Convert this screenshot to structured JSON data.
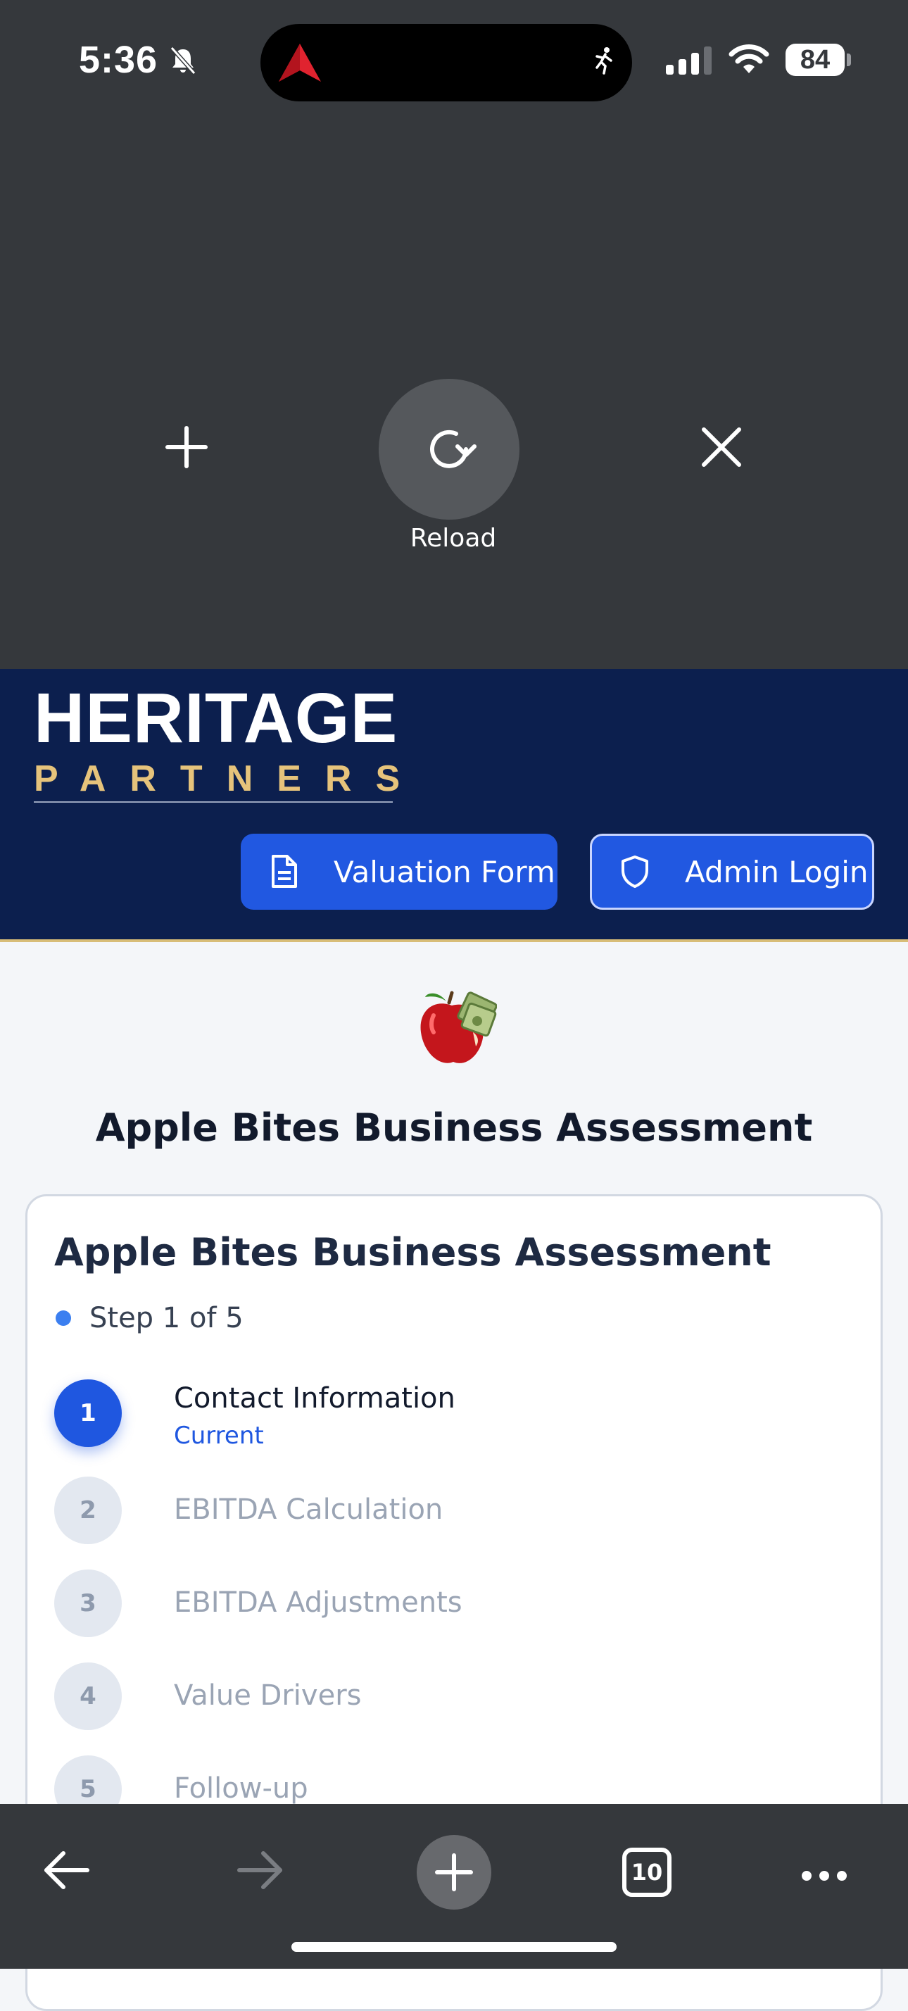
{
  "status_bar": {
    "time": "5:36",
    "battery": "84"
  },
  "pull_refresh": {
    "reload_label": "Reload"
  },
  "site_header": {
    "logo_line1": "HERITAGE",
    "logo_line2": "PARTNERS",
    "buttons": {
      "valuation": "Valuation Form",
      "admin": "Admin Login"
    },
    "colors": {
      "navy": "#0c1f4e",
      "gold": "#e6c37b",
      "button_blue": "#2158e1"
    }
  },
  "page": {
    "heading": "Apple Bites Business Assessment"
  },
  "card": {
    "title": "Apple Bites Business Assessment",
    "step_indicator": "Step 1 of 5",
    "steps": [
      {
        "number": "1",
        "label": "Contact Information",
        "status": "Current"
      },
      {
        "number": "2",
        "label": "EBITDA Calculation"
      },
      {
        "number": "3",
        "label": "EBITDA Adjustments"
      },
      {
        "number": "4",
        "label": "Value Drivers"
      },
      {
        "number": "5",
        "label": "Follow-up"
      }
    ]
  },
  "browser_toolbar": {
    "tab_count": "10"
  }
}
